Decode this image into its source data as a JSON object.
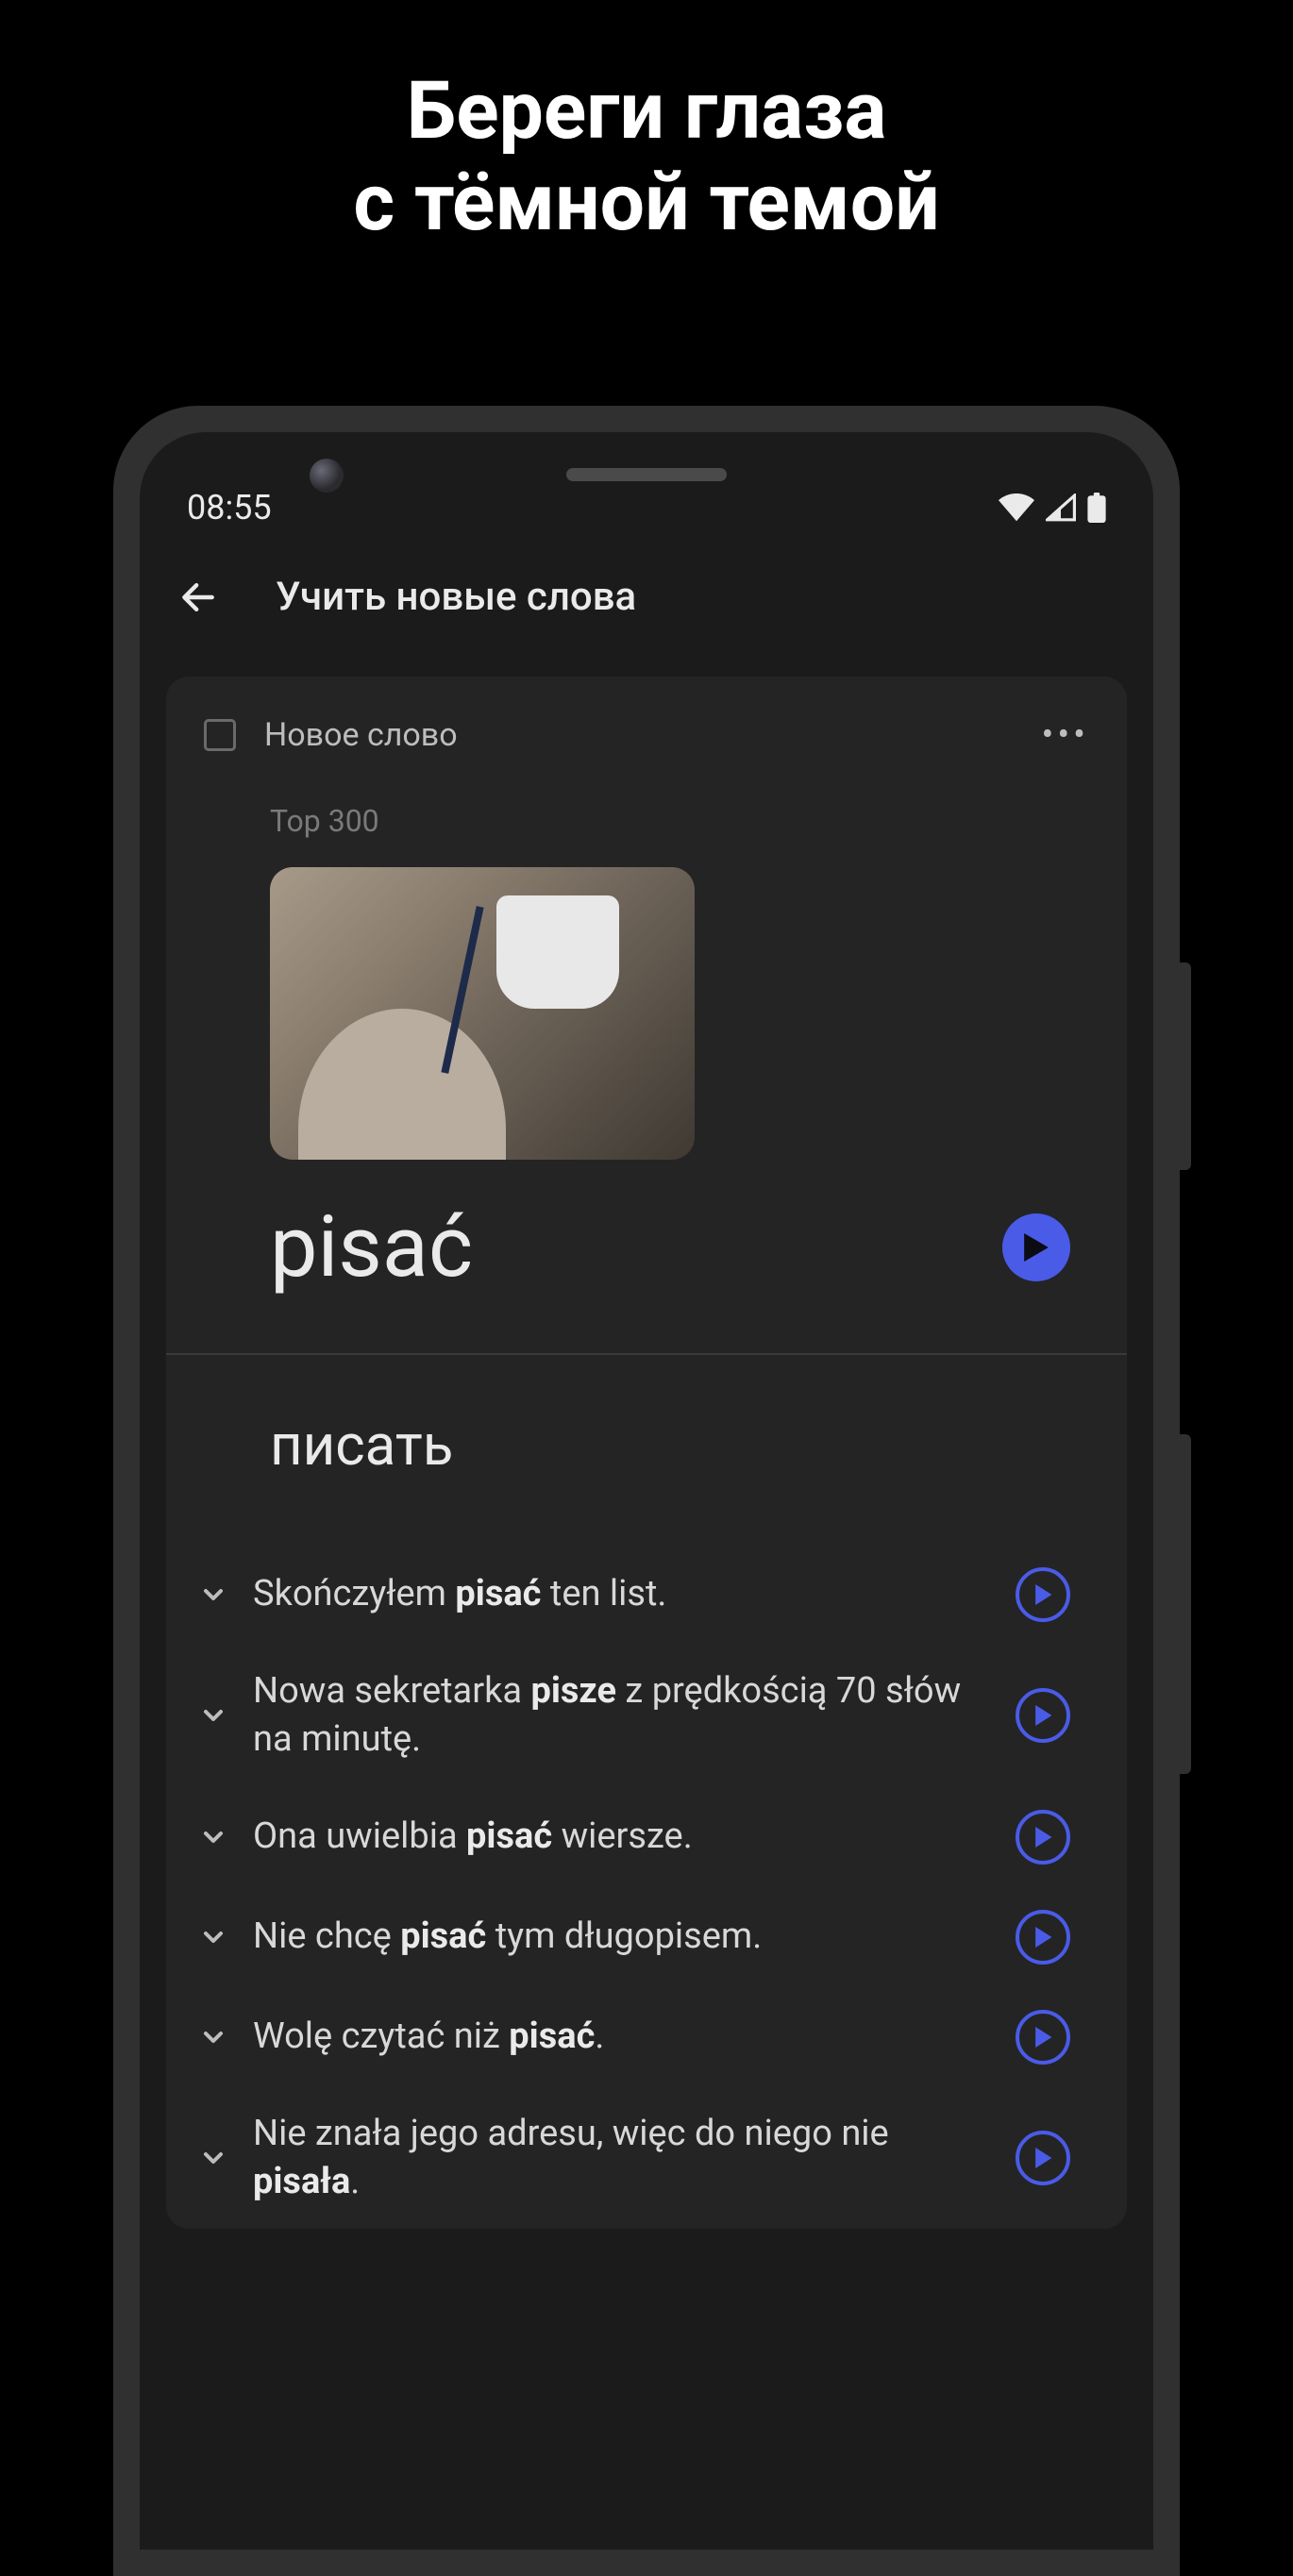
{
  "promo": {
    "line1": "Береги глаза",
    "line2": "с тёмной темой"
  },
  "status": {
    "time": "08:55"
  },
  "appbar": {
    "title": "Учить новые слова"
  },
  "card": {
    "new_word_label": "Новое слово",
    "category": "Top 300",
    "word": "pisać",
    "translation": "писать"
  },
  "examples": [
    {
      "pre": "Skończyłem ",
      "bold": "pisać",
      "post": " ten list."
    },
    {
      "pre": "Nowa sekretarka ",
      "bold": "pisze",
      "post": " z prędkością 70 słów na minutę."
    },
    {
      "pre": "Ona uwielbia ",
      "bold": "pisać",
      "post": " wiersze."
    },
    {
      "pre": "Nie chcę ",
      "bold": "pisać",
      "post": " tym długopisem."
    },
    {
      "pre": "Wolę czytać niż ",
      "bold": "pisać",
      "post": "."
    },
    {
      "pre": "Nie znała jego adresu, więc do niego nie ",
      "bold": "pisała",
      "post": "."
    }
  ],
  "colors": {
    "accent": "#4a5be8",
    "bg_dark": "#1b1b1b",
    "card_bg": "#242424"
  }
}
